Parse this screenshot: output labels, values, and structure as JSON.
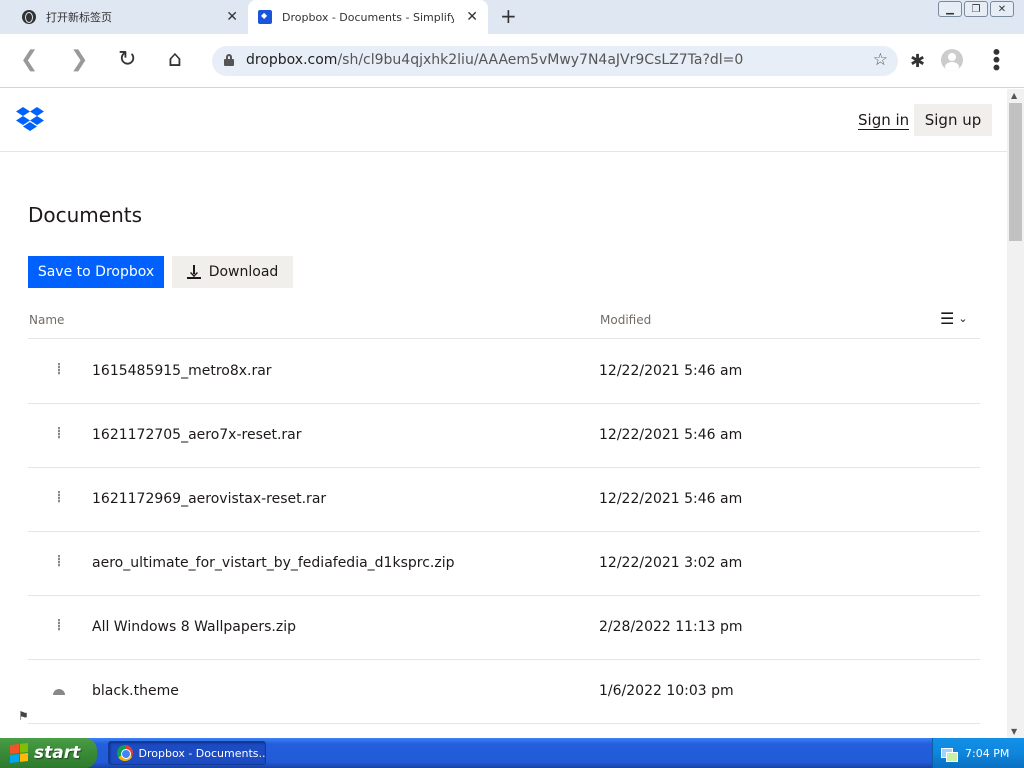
{
  "browser": {
    "tabs": [
      {
        "title": "打开新标签页",
        "active": false
      },
      {
        "title": "Dropbox - Documents - Simplify your",
        "active": true
      }
    ],
    "url": {
      "host": "dropbox.com",
      "path": "/sh/cl9bu4qjxhk2liu/AAAem5vMwy7N4aJVr9CsLZ7Ta?dl=0"
    },
    "window_controls": [
      "minimize",
      "restore",
      "close"
    ]
  },
  "header": {
    "sign_in": "Sign in",
    "sign_up": "Sign up"
  },
  "folder": {
    "title": "Documents",
    "save_button": "Save to Dropbox",
    "download_button": "Download"
  },
  "columns": {
    "name": "Name",
    "modified": "Modified"
  },
  "files": [
    {
      "name": "1615485915_metro8x.rar",
      "modified": "12/22/2021 5:46 am",
      "icon": "zip-file-icon"
    },
    {
      "name": "1621172705_aero7x-reset.rar",
      "modified": "12/22/2021 5:46 am",
      "icon": "zip-file-icon"
    },
    {
      "name": "1621172969_aerovistax-reset.rar",
      "modified": "12/22/2021 5:46 am",
      "icon": "zip-file-icon"
    },
    {
      "name": "aero_ultimate_for_vistart_by_fediafedia_d1ksprc.zip",
      "modified": "12/22/2021 3:02 am",
      "icon": "zip-file-icon"
    },
    {
      "name": "All Windows 8 Wallpapers.zip",
      "modified": "2/28/2022 11:13 pm",
      "icon": "zip-file-icon"
    },
    {
      "name": "black.theme",
      "modified": "1/6/2022 10:03 pm",
      "icon": "theme-file-icon"
    }
  ],
  "taskbar": {
    "start_label": "start",
    "task_label": "Dropbox - Documents...",
    "clock": "7:04 PM"
  },
  "colors": {
    "accent_blue": "#0061fe",
    "button_grey": "#f1efec",
    "text": "#1e1919",
    "muted": "#736c64"
  }
}
